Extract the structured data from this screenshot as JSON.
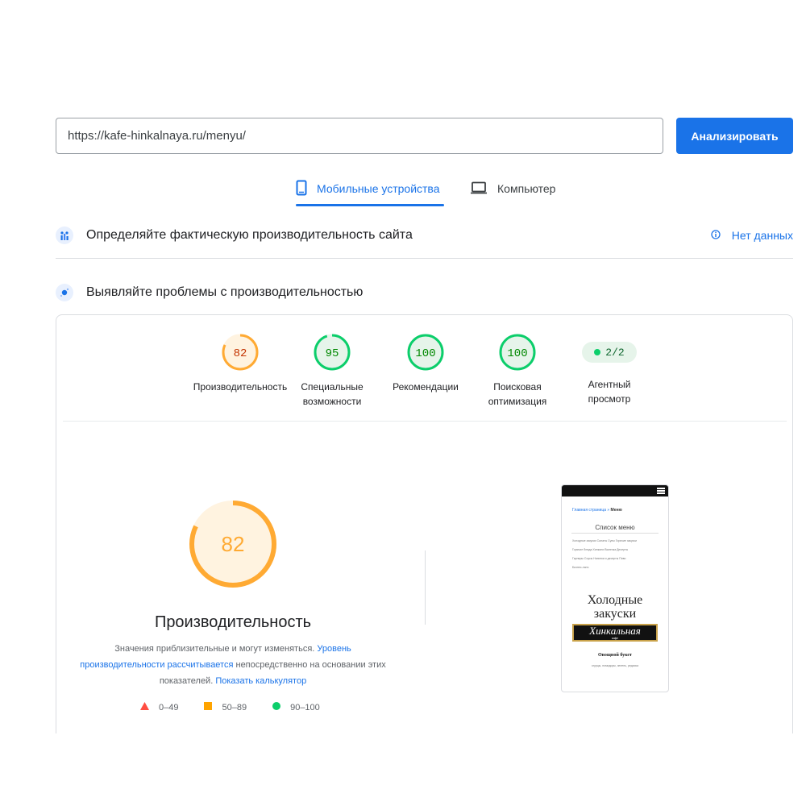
{
  "search": {
    "url": "https://kafe-hinkalnaya.ru/menyu/",
    "analyze_label": "Анализировать"
  },
  "tabs": [
    {
      "label": "Мобильные устройства",
      "icon": "smartphone-icon",
      "active": true
    },
    {
      "label": "Компьютер",
      "icon": "laptop-icon",
      "active": false
    }
  ],
  "field_data": {
    "label": "Определяйте фактическую производительность сайта",
    "status": "Нет данных",
    "status_icon": "info-icon"
  },
  "lab_data": {
    "label": "Выявляйте проблемы с производительностью"
  },
  "categories": [
    {
      "score": "82",
      "value": 82,
      "label_line1": "Производительность",
      "label_line2": "",
      "color": "#fa3"
    },
    {
      "score": "95",
      "value": 95,
      "label_line1": "Специальные",
      "label_line2": "возможности",
      "color": "#0cce6b"
    },
    {
      "score": "100",
      "value": 100,
      "label_line1": "Рекомендации",
      "label_line2": "",
      "color": "#0cce6b"
    },
    {
      "score": "100",
      "value": 100,
      "label_line1": "Поисковая",
      "label_line2": "оптимизация",
      "color": "#0cce6b"
    }
  ],
  "pwa": {
    "value": "2/2",
    "label_line1": "Агентный",
    "label_line2": "просмотр"
  },
  "performance": {
    "score": "82",
    "value": 82,
    "title": "Производительность",
    "desc_part1": "Значения приблизительные и могут изменяться. ",
    "desc_link1": "Уровень производительности рассчитывается",
    "desc_part2": " непосредственно на основании этих показателей. ",
    "desc_link2": "Показать калькулятор"
  },
  "legend": [
    {
      "range": "0–49",
      "color": "#ff4e42",
      "shape": "triangle"
    },
    {
      "range": "50–89",
      "color": "#ffa400",
      "shape": "square"
    },
    {
      "range": "90–100",
      "color": "#0cce6b",
      "shape": "circle"
    }
  ],
  "screenshot": {
    "breadcrumb_home": "Главная страница",
    "breadcrumb_sep": " » ",
    "breadcrumb_current": "Меню",
    "menu_title": "Список меню",
    "links": [
      "Холодные закуски   Салаты   Супы   Горячие закуски",
      "Горячие блюда   Хинкали   Выпечка   Десерты",
      "Гарниры   Соусы   Напитки и десерты   Пиво",
      "Бизнес-ланч"
    ],
    "heading_line1": "Холодные",
    "heading_line2": "закуски",
    "logo_text": "Хинкальная",
    "logo_sub": "кафе",
    "dish": "Овощной букет",
    "dish_desc": "огурцы, помидоры, зелень, редиска"
  }
}
